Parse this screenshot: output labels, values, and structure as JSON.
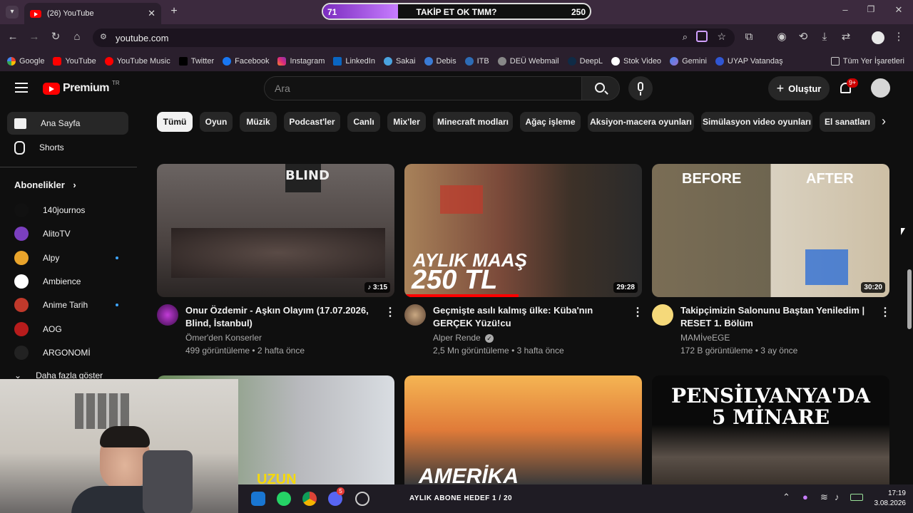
{
  "browser": {
    "tab_title": "(26) YouTube",
    "url": "youtube.com",
    "bookmarks": [
      "Google",
      "YouTube",
      "YouTube Music",
      "Twitter",
      "Facebook",
      "Instagram",
      "LinkedIn",
      "Sakai",
      "Debis",
      "ITB",
      "DEÜ Webmail",
      "DeepL",
      "Stok Video",
      "Gemini",
      "UYAP Vatandaş"
    ],
    "all_bookmarks": "Tüm Yer İşaretleri"
  },
  "overlay": {
    "left_value": "71",
    "label": "TAKİP ET OK TMM?",
    "right_value": "250",
    "progress": 0.28,
    "goal_label": "AYLIK ABONE HEDEF 1 / 20"
  },
  "youtube": {
    "logo": "Premium",
    "region": "TR",
    "search_placeholder": "Ara",
    "create_label": "Oluştur",
    "notification_badge": "9+",
    "chips": [
      "Tümü",
      "Oyun",
      "Müzik",
      "Podcast'ler",
      "Canlı",
      "Mix'ler",
      "Minecraft modları",
      "Ağaç işleme",
      "Aksiyon-macera oyunları",
      "Simülasyon video oyunları",
      "El sanatları"
    ],
    "sidebar": {
      "home": "Ana Sayfa",
      "shorts": "Shorts",
      "subs_header": "Abonelikler",
      "subs": [
        {
          "name": "140journos",
          "dot": false,
          "color": "#111111"
        },
        {
          "name": "AlitoTV",
          "dot": false,
          "color": "#7b3fbf"
        },
        {
          "name": "Alpy",
          "dot": true,
          "color": "#e9a42b"
        },
        {
          "name": "Ambience",
          "dot": false,
          "color": "#ffffff"
        },
        {
          "name": "Anime Tarih",
          "dot": true,
          "color": "#c0392b"
        },
        {
          "name": "AOG",
          "dot": false,
          "color": "#b71c1c"
        },
        {
          "name": "ARGONOMİ",
          "dot": false,
          "color": "#222222"
        }
      ],
      "more": "Daha fazla göster"
    },
    "videos": [
      {
        "title": "Onur Özdemir - Aşkın Olayım (17.07.2026, Blind, İstanbul)",
        "channel": "Ömer'den Konserler",
        "meta": "499 görüntüleme • 2 hafta önce",
        "duration": "3:15",
        "thumb_text": "BLIND"
      },
      {
        "title": "Geçmişte asılı kalmış ülke: Küba'nın GERÇEK Yüzü!cu",
        "channel": "Alper Rende",
        "meta": "2,5 Mn görüntüleme • 3 hafta önce",
        "duration": "29:28",
        "thumb_text": "AYLIK MAAŞ",
        "thumb_text2": "250 TL"
      },
      {
        "title": "Takipçimizin Salonunu Baştan Yeniledim | RESET 1. Bölüm",
        "channel": "MAMİveEGE",
        "meta": "172 B görüntüleme • 3 ay önce",
        "duration": "30:20",
        "thumb_text": "BEFORE",
        "thumb_text2": "AFTER"
      }
    ],
    "row2": [
      {
        "thumb_text": "UZUN"
      },
      {
        "thumb_text": "AMERİKA"
      },
      {
        "thumb_text": "PENSİLVANYA'DA",
        "thumb_text2": "5 MİNARE"
      }
    ]
  },
  "taskbar": {
    "time": "17:19",
    "date": "3.08.2026",
    "discord_badge": "5"
  }
}
